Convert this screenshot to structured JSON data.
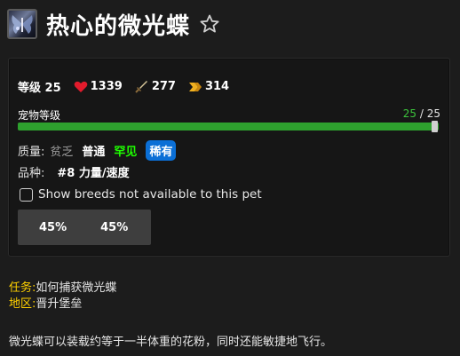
{
  "pet": {
    "name": "热心的微光蝶",
    "icon": "butterfly-icon",
    "favorite_icon": "star-outline-icon"
  },
  "stats": {
    "level_text": "等级 25",
    "health": "1339",
    "power": "277",
    "speed": "314",
    "health_icon": "heart-icon",
    "power_icon": "sword-icon",
    "speed_icon": "speed-arrow-icon"
  },
  "pet_level": {
    "label": "宠物等级",
    "current": "25",
    "separator": " / ",
    "max": "25",
    "progress_fraction": 1.0
  },
  "quality": {
    "label": "质量:",
    "options": [
      "贫乏",
      "普通",
      "罕见",
      "稀有"
    ],
    "selected": "稀有"
  },
  "breed": {
    "label": "品种:",
    "value": "#8 力量/速度"
  },
  "show_breeds": {
    "label": "Show breeds not available to this pet",
    "checked": false
  },
  "breed_percents": [
    "45%",
    "45%"
  ],
  "source": {
    "quest_label": "任务:",
    "quest_value": "如何捕获微光蝶",
    "zone_label": "地区:",
    "zone_value": "晋升堡垒"
  },
  "description": "微光蝶可以装载约等于一半体重的花粉，同时还能敏捷地飞行。",
  "colors": {
    "background": "#1c1c1c",
    "panel": "#161616",
    "level_bar": "#2ea12e",
    "level_current": "#3cc43c",
    "quality_poor": "#9d9d9d",
    "quality_uncommon": "#1eff00",
    "quality_rare_badge": "#0b6fd6",
    "label_gold": "#ffd100",
    "health_red": "#e21b2c",
    "speed_gold": "#f0b020"
  }
}
